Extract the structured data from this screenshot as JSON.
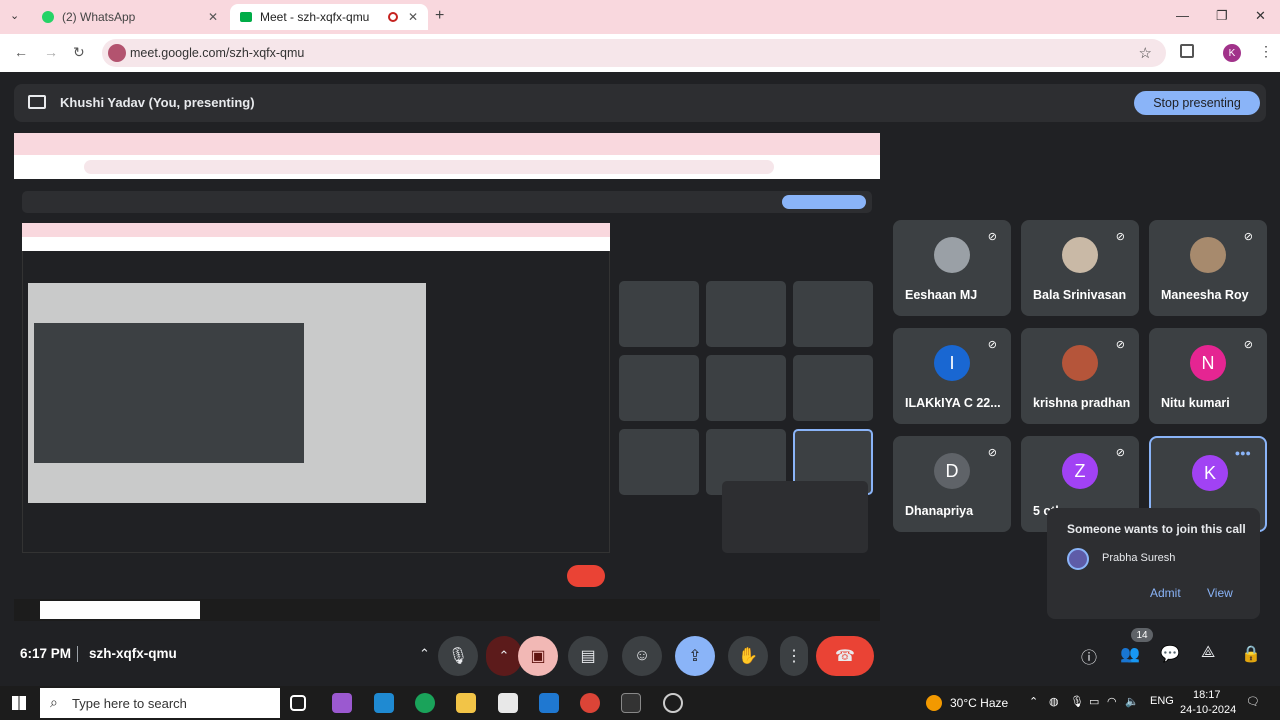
{
  "tabs": [
    {
      "label": "(2) WhatsApp",
      "active": false
    },
    {
      "label": "Meet - szh-xqfx-qmu",
      "active": true
    }
  ],
  "address": "meet.google.com/szh-xqfx-qmu",
  "profile_initial": "K",
  "presenting": {
    "label": "Khushi Yadav (You, presenting)",
    "stop": "Stop presenting"
  },
  "participants": [
    {
      "name": "Eeshaan MJ",
      "initial": "",
      "color": "#9aa0a6",
      "photo": true,
      "muted": true
    },
    {
      "name": "Bala Srinivasan",
      "initial": "",
      "color": "#c9b9a6",
      "photo": true,
      "muted": true
    },
    {
      "name": "Maneesha Roy",
      "initial": "",
      "color": "#a78a6d",
      "photo": true,
      "muted": true
    },
    {
      "name": "ILAKkIYA C 22...",
      "initial": "I",
      "color": "#1967d2",
      "muted": true
    },
    {
      "name": "krishna pradhan",
      "initial": "",
      "color": "#b5553a",
      "photo": true,
      "muted": true
    },
    {
      "name": "Nitu kumari",
      "initial": "N",
      "color": "#e52592",
      "muted": true
    },
    {
      "name": "Dhanapriya",
      "initial": "D",
      "color": "#5f6368",
      "muted": true
    },
    {
      "name": "5 others",
      "initial": "Z",
      "color": "#a142f4",
      "muted": true
    },
    {
      "name": "",
      "initial": "K",
      "color": "#a142f4",
      "speaking": true
    }
  ],
  "toast": {
    "title": "Someone wants to join this call",
    "person": "Prabha Suresh",
    "admit": "Admit",
    "view": "View"
  },
  "meeting": {
    "time": "6:17 PM",
    "code": "szh-xqfx-qmu"
  },
  "people_count": "14",
  "taskbar": {
    "search": "Type here to search",
    "weather": "30°C Haze",
    "lang": "ENG",
    "time": "18:17",
    "date": "24-10-2024"
  },
  "colors": {
    "accent": "#8ab4f8",
    "end_call": "#ea4335",
    "tab_bg": "#f9d8de"
  }
}
